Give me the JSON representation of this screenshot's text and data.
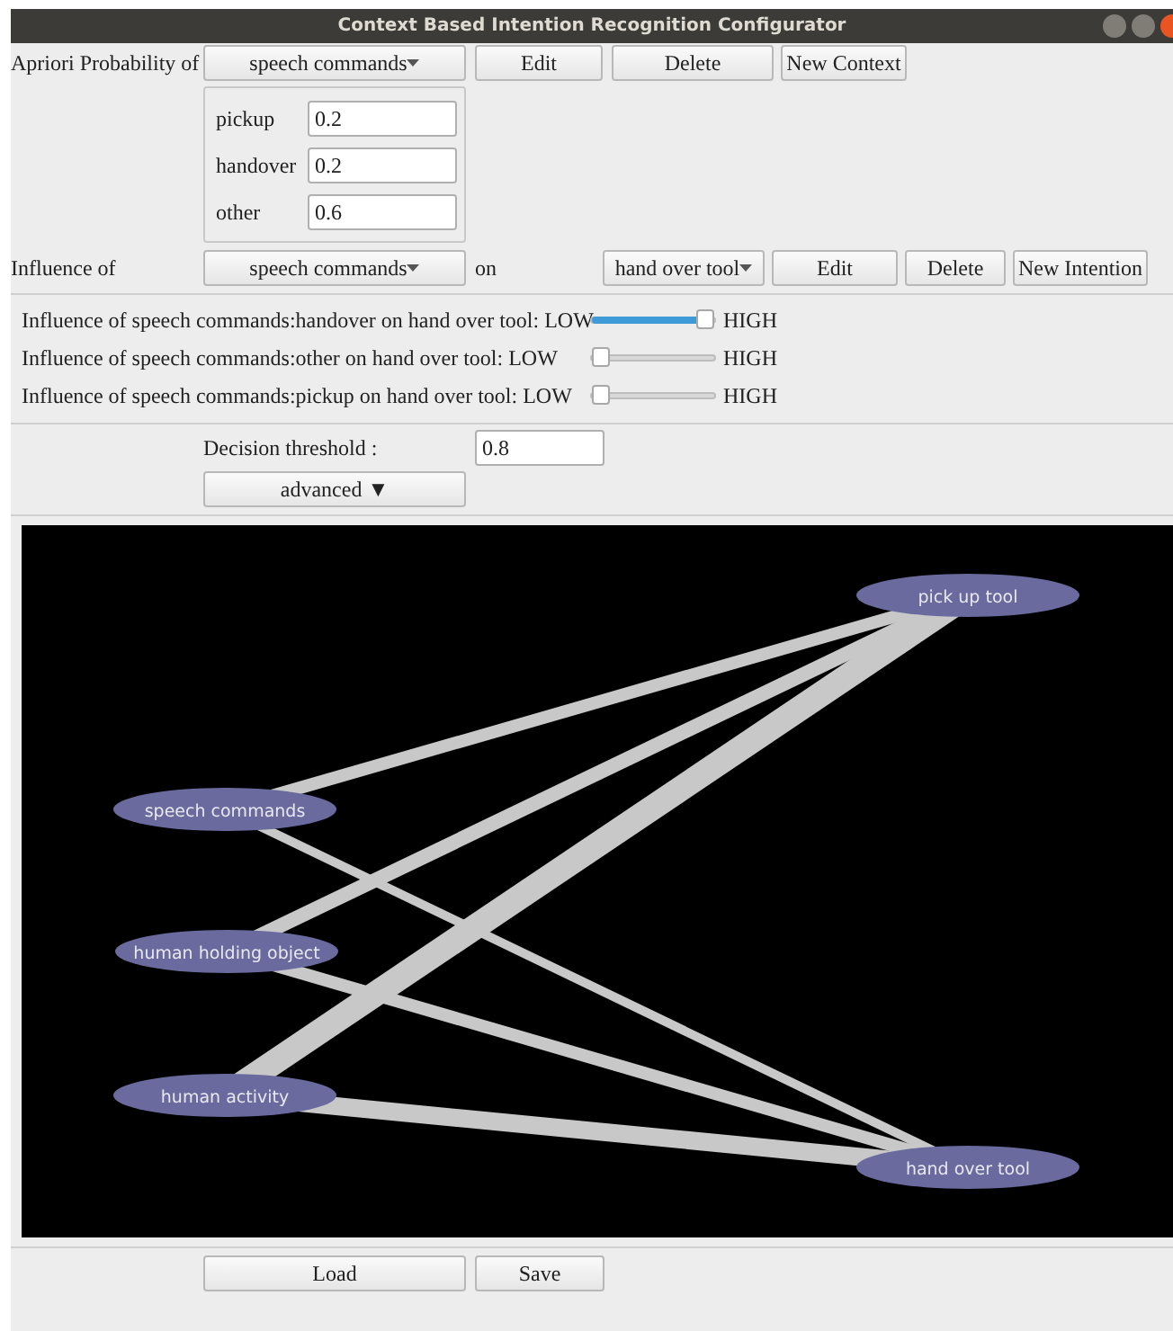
{
  "window": {
    "title": "Context Based Intention Recognition Configurator"
  },
  "apriori": {
    "label": "Apriori Probability of",
    "context": "speech commands",
    "buttons": [
      "Edit",
      "Delete",
      "New Context"
    ],
    "probabilities": [
      {
        "label": "pickup",
        "value": "0.2"
      },
      {
        "label": "handover",
        "value": "0.2"
      },
      {
        "label": "other",
        "value": "0.6"
      }
    ]
  },
  "influence": {
    "label": "Influence of",
    "context": "speech commands",
    "on_label": "on",
    "intention": "hand over tool",
    "buttons": [
      "Edit",
      "Delete",
      "New Intention"
    ],
    "sliders": [
      {
        "label": "Influence of speech commands:handover on hand over tool: LOW",
        "level": 1,
        "high": "HIGH"
      },
      {
        "label": "Influence of speech commands:other on hand over tool: LOW",
        "level": 0,
        "high": "HIGH"
      },
      {
        "label": "Influence of speech commands:pickup on hand over tool: LOW",
        "level": 0,
        "high": "HIGH"
      }
    ]
  },
  "decision_threshold": {
    "label": "Decision threshold :",
    "value": "0.8"
  },
  "advanced": {
    "label": "advanced ▼"
  },
  "graph": {
    "nodes": [
      {
        "label": "pick up tool"
      },
      {
        "label": "speech commands"
      },
      {
        "label": "human holding object"
      },
      {
        "label": "human activity"
      },
      {
        "label": "hand over tool"
      }
    ]
  },
  "footer_buttons": [
    "Load",
    "Save"
  ]
}
